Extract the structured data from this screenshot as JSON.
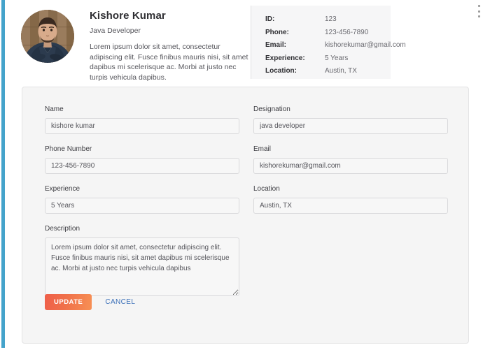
{
  "profile": {
    "name": "Kishore Kumar",
    "role": "Java Developer",
    "bio": "Lorem ipsum dolor sit amet, consectetur adipiscing elit. Fusce finibus mauris nisi, sit amet dapibus mi scelerisque ac. Morbi at justo nec turpis vehicula dapibus.",
    "avatar_alt": "profile-photo"
  },
  "info": {
    "rows": [
      {
        "label": "ID:",
        "value": "123"
      },
      {
        "label": "Phone:",
        "value": "123-456-7890"
      },
      {
        "label": "Email:",
        "value": "kishorekumar@gmail.com"
      },
      {
        "label": "Experience:",
        "value": "5 Years"
      },
      {
        "label": "Location:",
        "value": "Austin, TX"
      }
    ]
  },
  "menu": {
    "icon": "kebab-menu-icon"
  },
  "form": {
    "name": {
      "label": "Name",
      "value": "kishore kumar"
    },
    "designation": {
      "label": "Designation",
      "value": "java developer"
    },
    "phone": {
      "label": "Phone Number",
      "value": "123-456-7890"
    },
    "email": {
      "label": "Email",
      "value": "kishorekumar@gmail.com"
    },
    "experience": {
      "label": "Experience",
      "value": "5 Years"
    },
    "location": {
      "label": "Location",
      "value": "Austin, TX"
    },
    "description": {
      "label": "Description",
      "value": "Lorem ipsum dolor sit amet, consectetur adipiscing elit. Fusce finibus mauris nisi, sit amet dapibus mi scelerisque ac. Morbi at justo nec turpis vehicula dapibus"
    },
    "update_label": "UPDATE",
    "cancel_label": "CANCEL"
  },
  "colors": {
    "accent_rail": "#44a3cb",
    "button_gradient_start": "#ef5f4a",
    "button_gradient_end": "#f79054",
    "cancel_link": "#3a6fb8",
    "card_bg": "#f5f5f5",
    "info_bg": "#f6f6f7"
  }
}
